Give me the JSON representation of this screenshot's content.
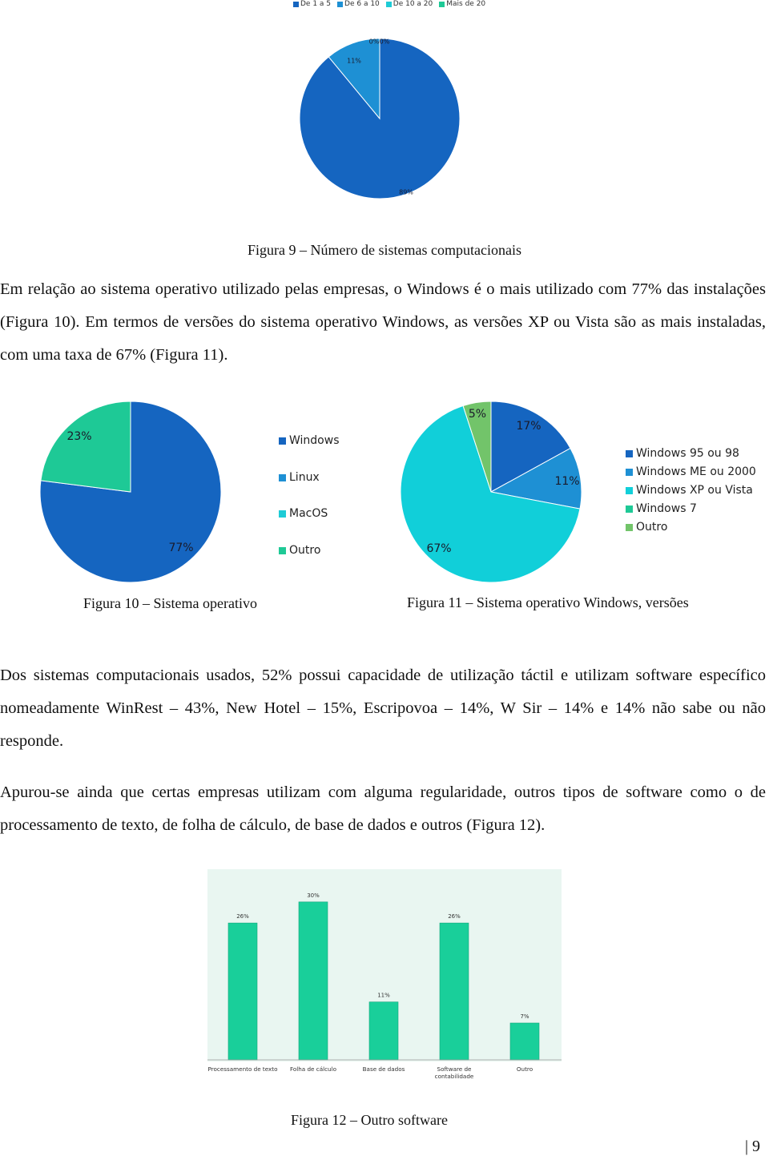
{
  "figure9": {
    "caption": "Figura 9 – Número de sistemas computacionais",
    "chart_data": {
      "type": "pie",
      "title": "",
      "legend_position": "top",
      "categories": [
        "De 1 a 5",
        "De 6 a 10",
        "De 10 a 20",
        "Mais de 20"
      ],
      "values": [
        89,
        11,
        0,
        0
      ],
      "labels": [
        "89%",
        "11%",
        "0%",
        "0%"
      ],
      "colors": [
        "#1565c0",
        "#1e90d4",
        "#1ecbd6",
        "#1ec996"
      ]
    }
  },
  "paragraph1": "Em relação ao sistema operativo utilizado pelas empresas, o Windows é o mais utilizado com 77% das instalações (Figura 10). Em termos de versões do sistema operativo Windows, as versões XP ou Vista são as mais instaladas, com uma taxa de 67% (Figura 11).",
  "figure10": {
    "caption": "Figura 10 – Sistema operativo",
    "chart_data": {
      "type": "pie",
      "title": "",
      "legend_position": "right",
      "categories": [
        "Windows",
        "Linux",
        "MacOS",
        "Outro"
      ],
      "values": [
        77,
        0,
        0,
        23
      ],
      "labels": [
        "77%",
        "",
        "",
        "23%"
      ],
      "colors": [
        "#1565c0",
        "#1e90d4",
        "#1ecbd6",
        "#1ec996"
      ]
    }
  },
  "figure11": {
    "caption": "Figura 11 – Sistema operativo Windows, versões",
    "chart_data": {
      "type": "pie",
      "title": "",
      "legend_position": "right",
      "categories": [
        "Windows 95 ou 98",
        "Windows ME ou 2000",
        "Windows XP ou Vista",
        "Windows 7",
        "Outro"
      ],
      "values": [
        17,
        11,
        67,
        0,
        5
      ],
      "labels": [
        "17%",
        "11%",
        "67%",
        "",
        "5%"
      ],
      "colors": [
        "#1565c0",
        "#1e90d4",
        "#11cfd9",
        "#1ec996",
        "#72c46a"
      ]
    }
  },
  "paragraph2": "Dos sistemas computacionais usados,  52% possui capacidade de utilização táctil e utilizam software específico nomeadamente WinRest – 43%, New Hotel – 15%, Escripovoa – 14%, W Sir – 14% e 14% não sabe ou não responde.",
  "paragraph3": "Apurou-se ainda que certas empresas utilizam com alguma regularidade, outros tipos de software como o de processamento de texto, de folha de cálculo, de base de dados e outros (Figura 12).",
  "figure12": {
    "caption": "Figura 12 – Outro software",
    "chart_data": {
      "type": "bar",
      "title": "",
      "xlabel": "",
      "ylabel": "",
      "ylim": [
        0,
        35
      ],
      "grid": false,
      "categories": [
        "Processamento de texto",
        "Folha de cálculo",
        "Base de dados",
        "Software de contabilidade",
        "Outro"
      ],
      "category_lines": [
        [
          "Processamento de texto"
        ],
        [
          "Folha de cálculo"
        ],
        [
          "Base de dados"
        ],
        [
          "Software de",
          "contabilidade"
        ],
        [
          "Outro"
        ]
      ],
      "values": [
        26,
        30,
        11,
        26,
        7
      ],
      "labels": [
        "26%",
        "30%",
        "11%",
        "26%",
        "7%"
      ],
      "bar_color": "#19cf9a",
      "background": "#e9f6f1"
    }
  },
  "page_number": "| 9"
}
